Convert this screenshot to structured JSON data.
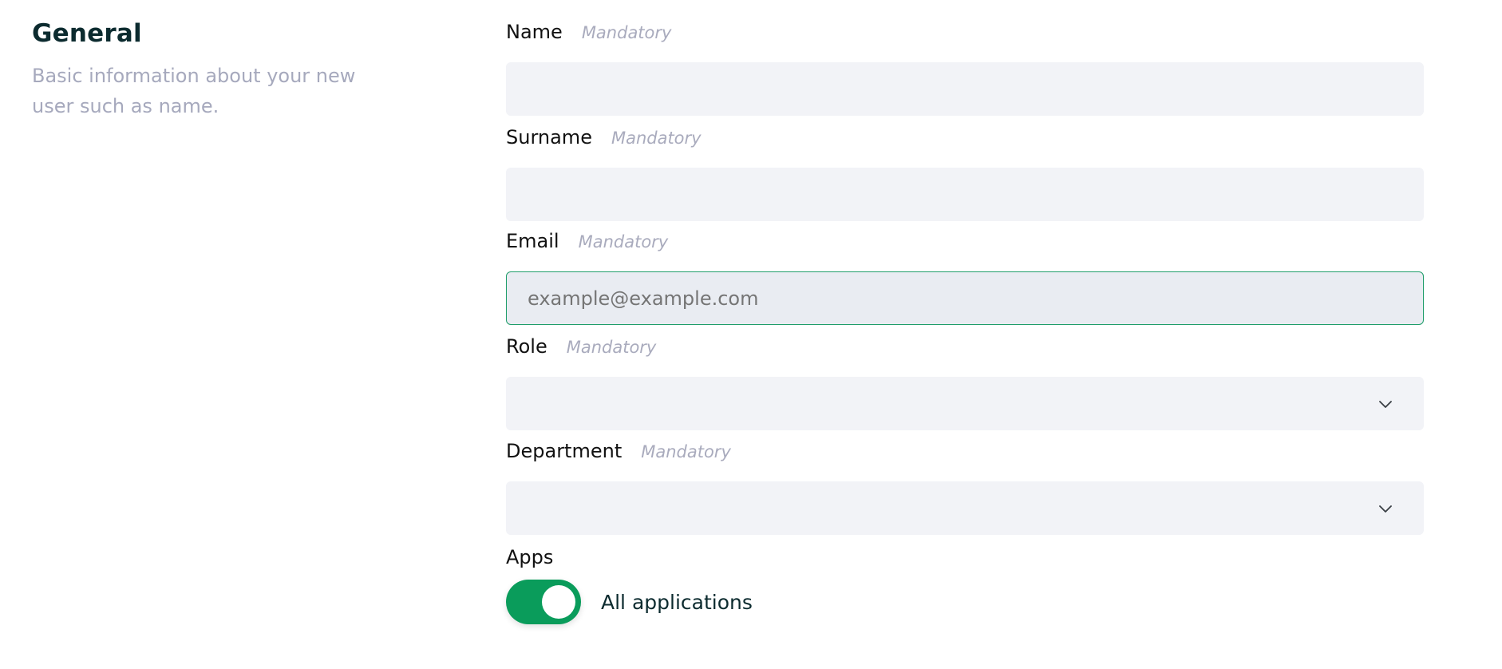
{
  "section": {
    "title": "General",
    "description": "Basic information about your new user such as name."
  },
  "fields": {
    "name": {
      "label": "Name",
      "hint": "Mandatory",
      "value": "",
      "placeholder": ""
    },
    "surname": {
      "label": "Surname",
      "hint": "Mandatory",
      "value": "",
      "placeholder": ""
    },
    "email": {
      "label": "Email",
      "hint": "Mandatory",
      "value": "",
      "placeholder": "example@example.com"
    },
    "role": {
      "label": "Role",
      "hint": "Mandatory",
      "selected": ""
    },
    "department": {
      "label": "Department",
      "hint": "Mandatory",
      "selected": ""
    }
  },
  "apps": {
    "label": "Apps",
    "toggle_label": "All applications",
    "toggle_on": true
  },
  "colors": {
    "accent": "#0a9c5b",
    "focus_border": "#1f9d6a",
    "input_bg": "#f2f3f7",
    "hint": "#a9abbd",
    "title": "#0c2b2f"
  },
  "icons": {
    "select_arrow": "chevron-down-icon"
  }
}
